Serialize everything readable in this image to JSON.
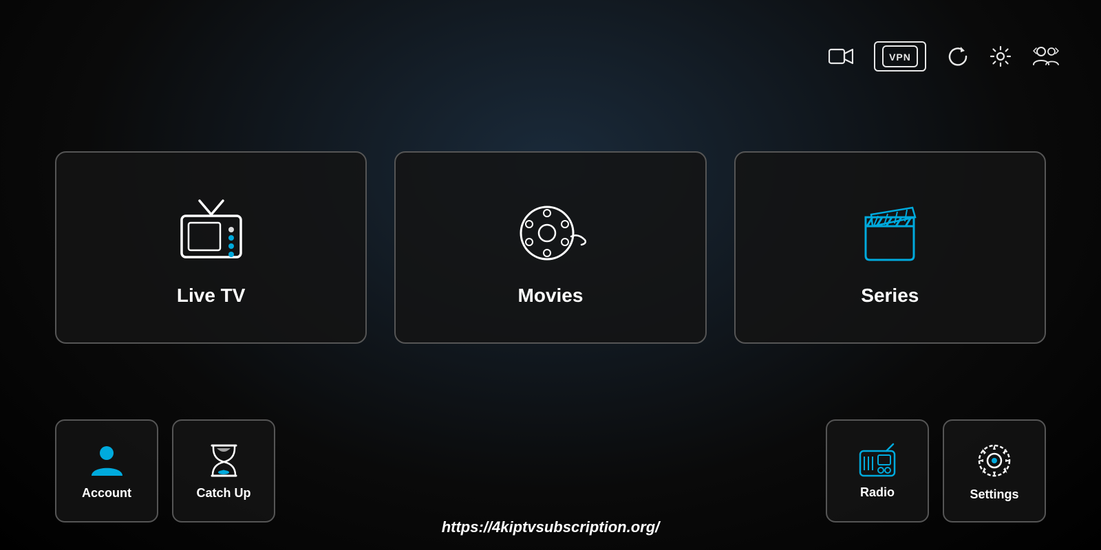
{
  "header": {
    "icons": [
      {
        "name": "video-camera-icon",
        "label": "Video Camera"
      },
      {
        "name": "vpn-icon",
        "label": "VPN"
      },
      {
        "name": "refresh-icon",
        "label": "Refresh"
      },
      {
        "name": "settings-gear-icon",
        "label": "Settings"
      },
      {
        "name": "users-icon",
        "label": "Users"
      }
    ]
  },
  "main_cards": [
    {
      "id": "live-tv",
      "label": "Live TV"
    },
    {
      "id": "movies",
      "label": "Movies"
    },
    {
      "id": "series",
      "label": "Series"
    }
  ],
  "bottom_left_cards": [
    {
      "id": "account",
      "label": "Account"
    },
    {
      "id": "catch-up",
      "label": "Catch Up"
    }
  ],
  "bottom_right_cards": [
    {
      "id": "radio",
      "label": "Radio"
    },
    {
      "id": "settings",
      "label": "Settings"
    }
  ],
  "url": "https://4kiptvsubscription.org/"
}
